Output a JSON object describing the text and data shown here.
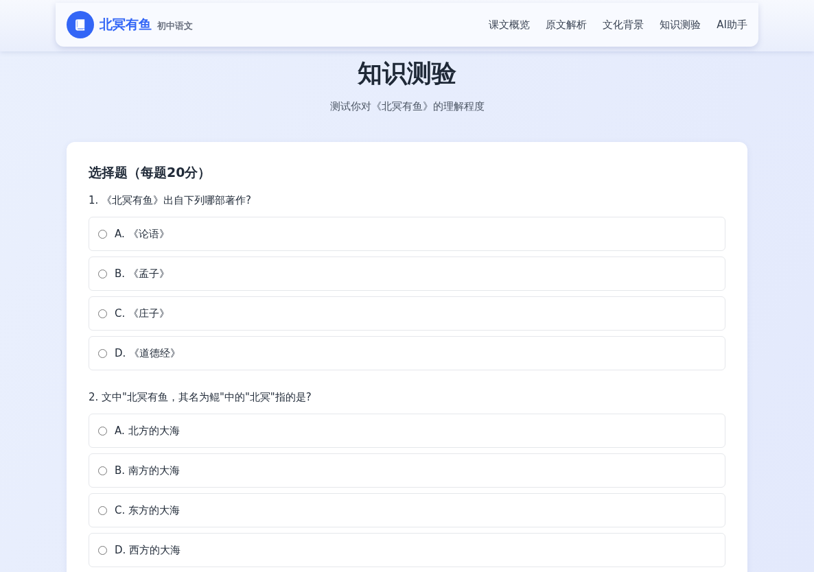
{
  "brand": {
    "title": "北冥有鱼",
    "subtitle": "初中语文"
  },
  "nav": [
    "课文概览",
    "原文解析",
    "文化背景",
    "知识测验",
    "AI助手"
  ],
  "page": {
    "title": "知识测验",
    "subtitle": "测试你对《北冥有鱼》的理解程度"
  },
  "quiz": {
    "section_title": "选择题（每题20分）",
    "questions": [
      {
        "text": "1. 《北冥有鱼》出自下列哪部著作?",
        "options": [
          {
            "label": "A. 《论语》",
            "selected": false
          },
          {
            "label": "B. 《孟子》",
            "selected": false
          },
          {
            "label": "C. 《庄子》",
            "selected": false
          },
          {
            "label": "D. 《道德经》",
            "selected": false
          }
        ]
      },
      {
        "text": "2. 文中\"北冥有鱼，其名为鲲\"中的\"北冥\"指的是?",
        "options": [
          {
            "label": "A. 北方的大海",
            "selected": false
          },
          {
            "label": "B. 南方的大海",
            "selected": false
          },
          {
            "label": "C. 东方的大海",
            "selected": false
          },
          {
            "label": "D. 西方的大海",
            "selected": false
          }
        ]
      }
    ]
  }
}
